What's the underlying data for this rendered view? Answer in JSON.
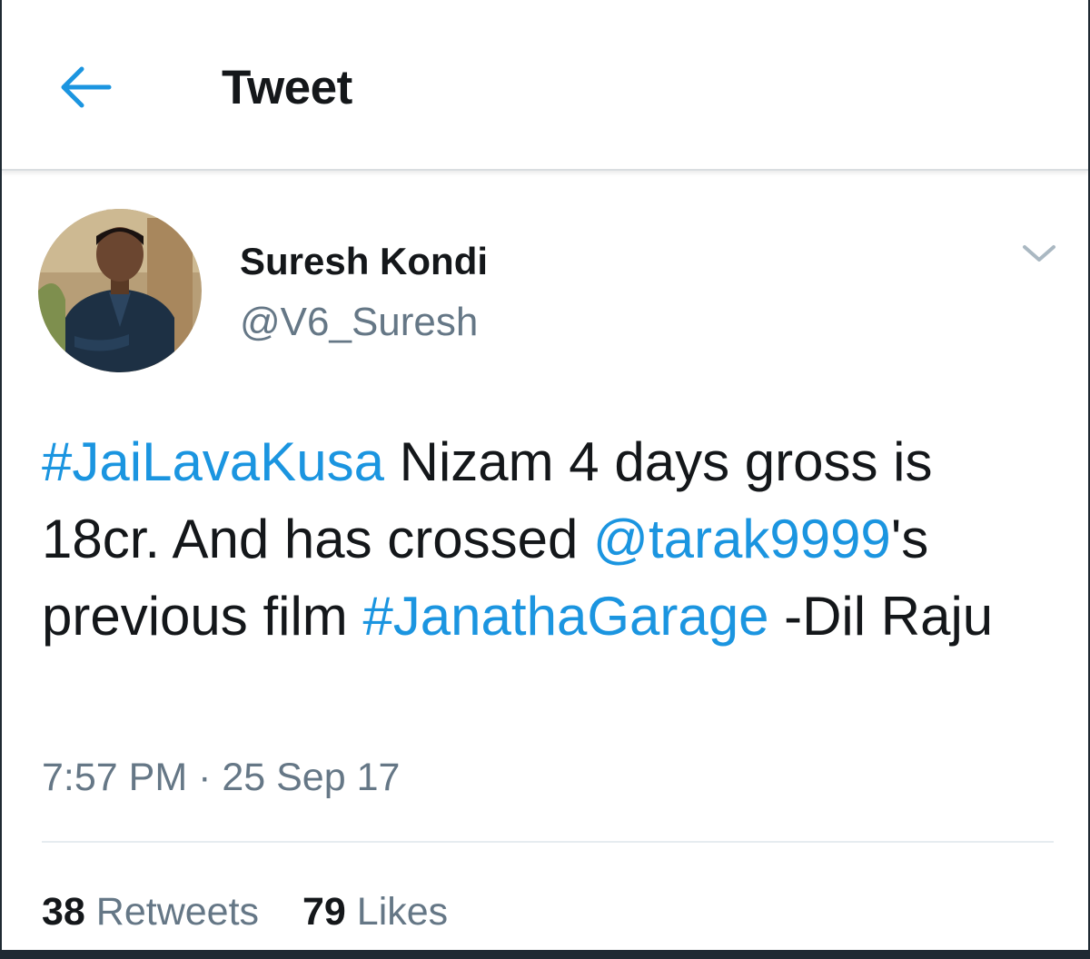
{
  "header": {
    "back_icon": "arrow-left-icon",
    "title": "Tweet"
  },
  "tweet": {
    "author": {
      "display_name": "Suresh Kondi",
      "handle": "@V6_Suresh",
      "avatar": "user-avatar-photo"
    },
    "more_icon": "chevron-down-icon",
    "segments": [
      {
        "text": "#JaiLavaKusa",
        "link": true
      },
      {
        "text": " Nizam 4 days gross is 18cr. And has crossed ",
        "link": false
      },
      {
        "text": "@tarak9999",
        "link": true
      },
      {
        "text": "'s previous film ",
        "link": false
      },
      {
        "text": "#JanathaGarage",
        "link": true
      },
      {
        "text": " -Dil Raju",
        "link": false
      }
    ],
    "timestamp": "7:57 PM · 25 Sep 17",
    "stats": {
      "retweets_count": "38",
      "retweets_label": "Retweets",
      "likes_count": "79",
      "likes_label": "Likes"
    }
  },
  "colors": {
    "accent": "#1b95e0",
    "text_primary": "#14171a",
    "text_secondary": "#657786"
  }
}
